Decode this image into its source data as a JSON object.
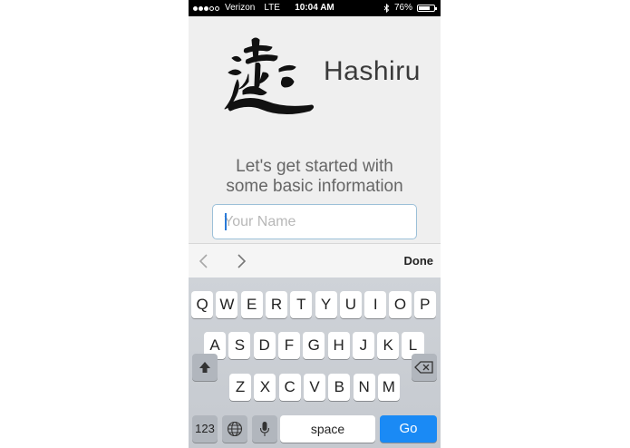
{
  "status_bar": {
    "carrier": "Verizon",
    "network": "LTE",
    "time": "10:04 AM",
    "battery": "76%",
    "battery_level": 0.76
  },
  "app": {
    "name": "Hashiru",
    "logo_icon": "hashiru-kanji-logo"
  },
  "intro": {
    "line1": "Let's get started with",
    "line2": "some basic information"
  },
  "name_field": {
    "value": "",
    "placeholder": "Your Name"
  },
  "accessory_bar": {
    "prev_icon": "chevron-left-icon",
    "next_icon": "chevron-right-icon",
    "done_label": "Done"
  },
  "keyboard": {
    "row1": [
      "Q",
      "W",
      "E",
      "R",
      "T",
      "Y",
      "U",
      "I",
      "O",
      "P"
    ],
    "row2": [
      "A",
      "S",
      "D",
      "F",
      "G",
      "H",
      "J",
      "K",
      "L"
    ],
    "row3": [
      "Z",
      "X",
      "C",
      "V",
      "B",
      "N",
      "M"
    ],
    "numbers_label": "123",
    "space_label": "space",
    "go_label": "Go",
    "go_color": "#1a8af5"
  }
}
